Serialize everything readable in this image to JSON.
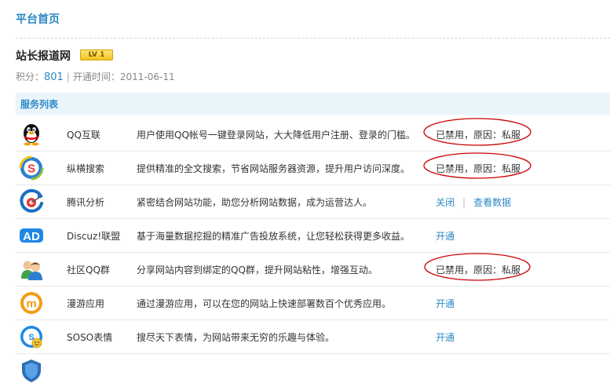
{
  "page_title": "平台首页",
  "site": {
    "name": "站长报道网",
    "level_badge": "LV 1",
    "points_label": "积分：",
    "points_value": "801",
    "open_time_label": "开通时间：",
    "open_time_value": "2011-06-11"
  },
  "section_title": "服务列表",
  "colors": {
    "accent": "#2b88c5",
    "header_bg": "#eaf5fb",
    "annotation": "#cc0000"
  },
  "services": [
    {
      "name": "QQ互联",
      "icon": "qq-penguin-icon",
      "description": "用户使用QQ帐号一键登录网站，大大降低用户注册、登录的门槛。",
      "status": "已禁用，原因：私服"
    },
    {
      "name": "纵横搜索",
      "icon": "search-s-icon",
      "description": "提供精准的全文搜索，节省网站服务器资源，提升用户访问深度。",
      "status": "已禁用，原因：私服"
    },
    {
      "name": "腾讯分析",
      "icon": "analytics-icon",
      "description": "紧密结合网站功能，助您分析网站数据，成为运营达人。",
      "action_close": "关闭",
      "action_view": "查看数据"
    },
    {
      "name": "Discuz!联盟",
      "icon": "ad-icon",
      "description": "基于海量数据挖掘的精准广告投放系统，让您轻松获得更多收益。",
      "action_open": "开通"
    },
    {
      "name": "社区QQ群",
      "icon": "qq-group-icon",
      "description": "分享网站内容到绑定的QQ群，提升网站粘性，增强互动。",
      "status": "已禁用，原因：私服"
    },
    {
      "name": "漫游应用",
      "icon": "manyou-icon",
      "description": "通过漫游应用，可以在您的网站上快速部署数百个优秀应用。",
      "action_open": "开通"
    },
    {
      "name": "SOSO表情",
      "icon": "soso-smiley-icon",
      "description": "搜尽天下表情，为网站带来无穷的乐趣与体验。",
      "action_open": "开通"
    }
  ]
}
